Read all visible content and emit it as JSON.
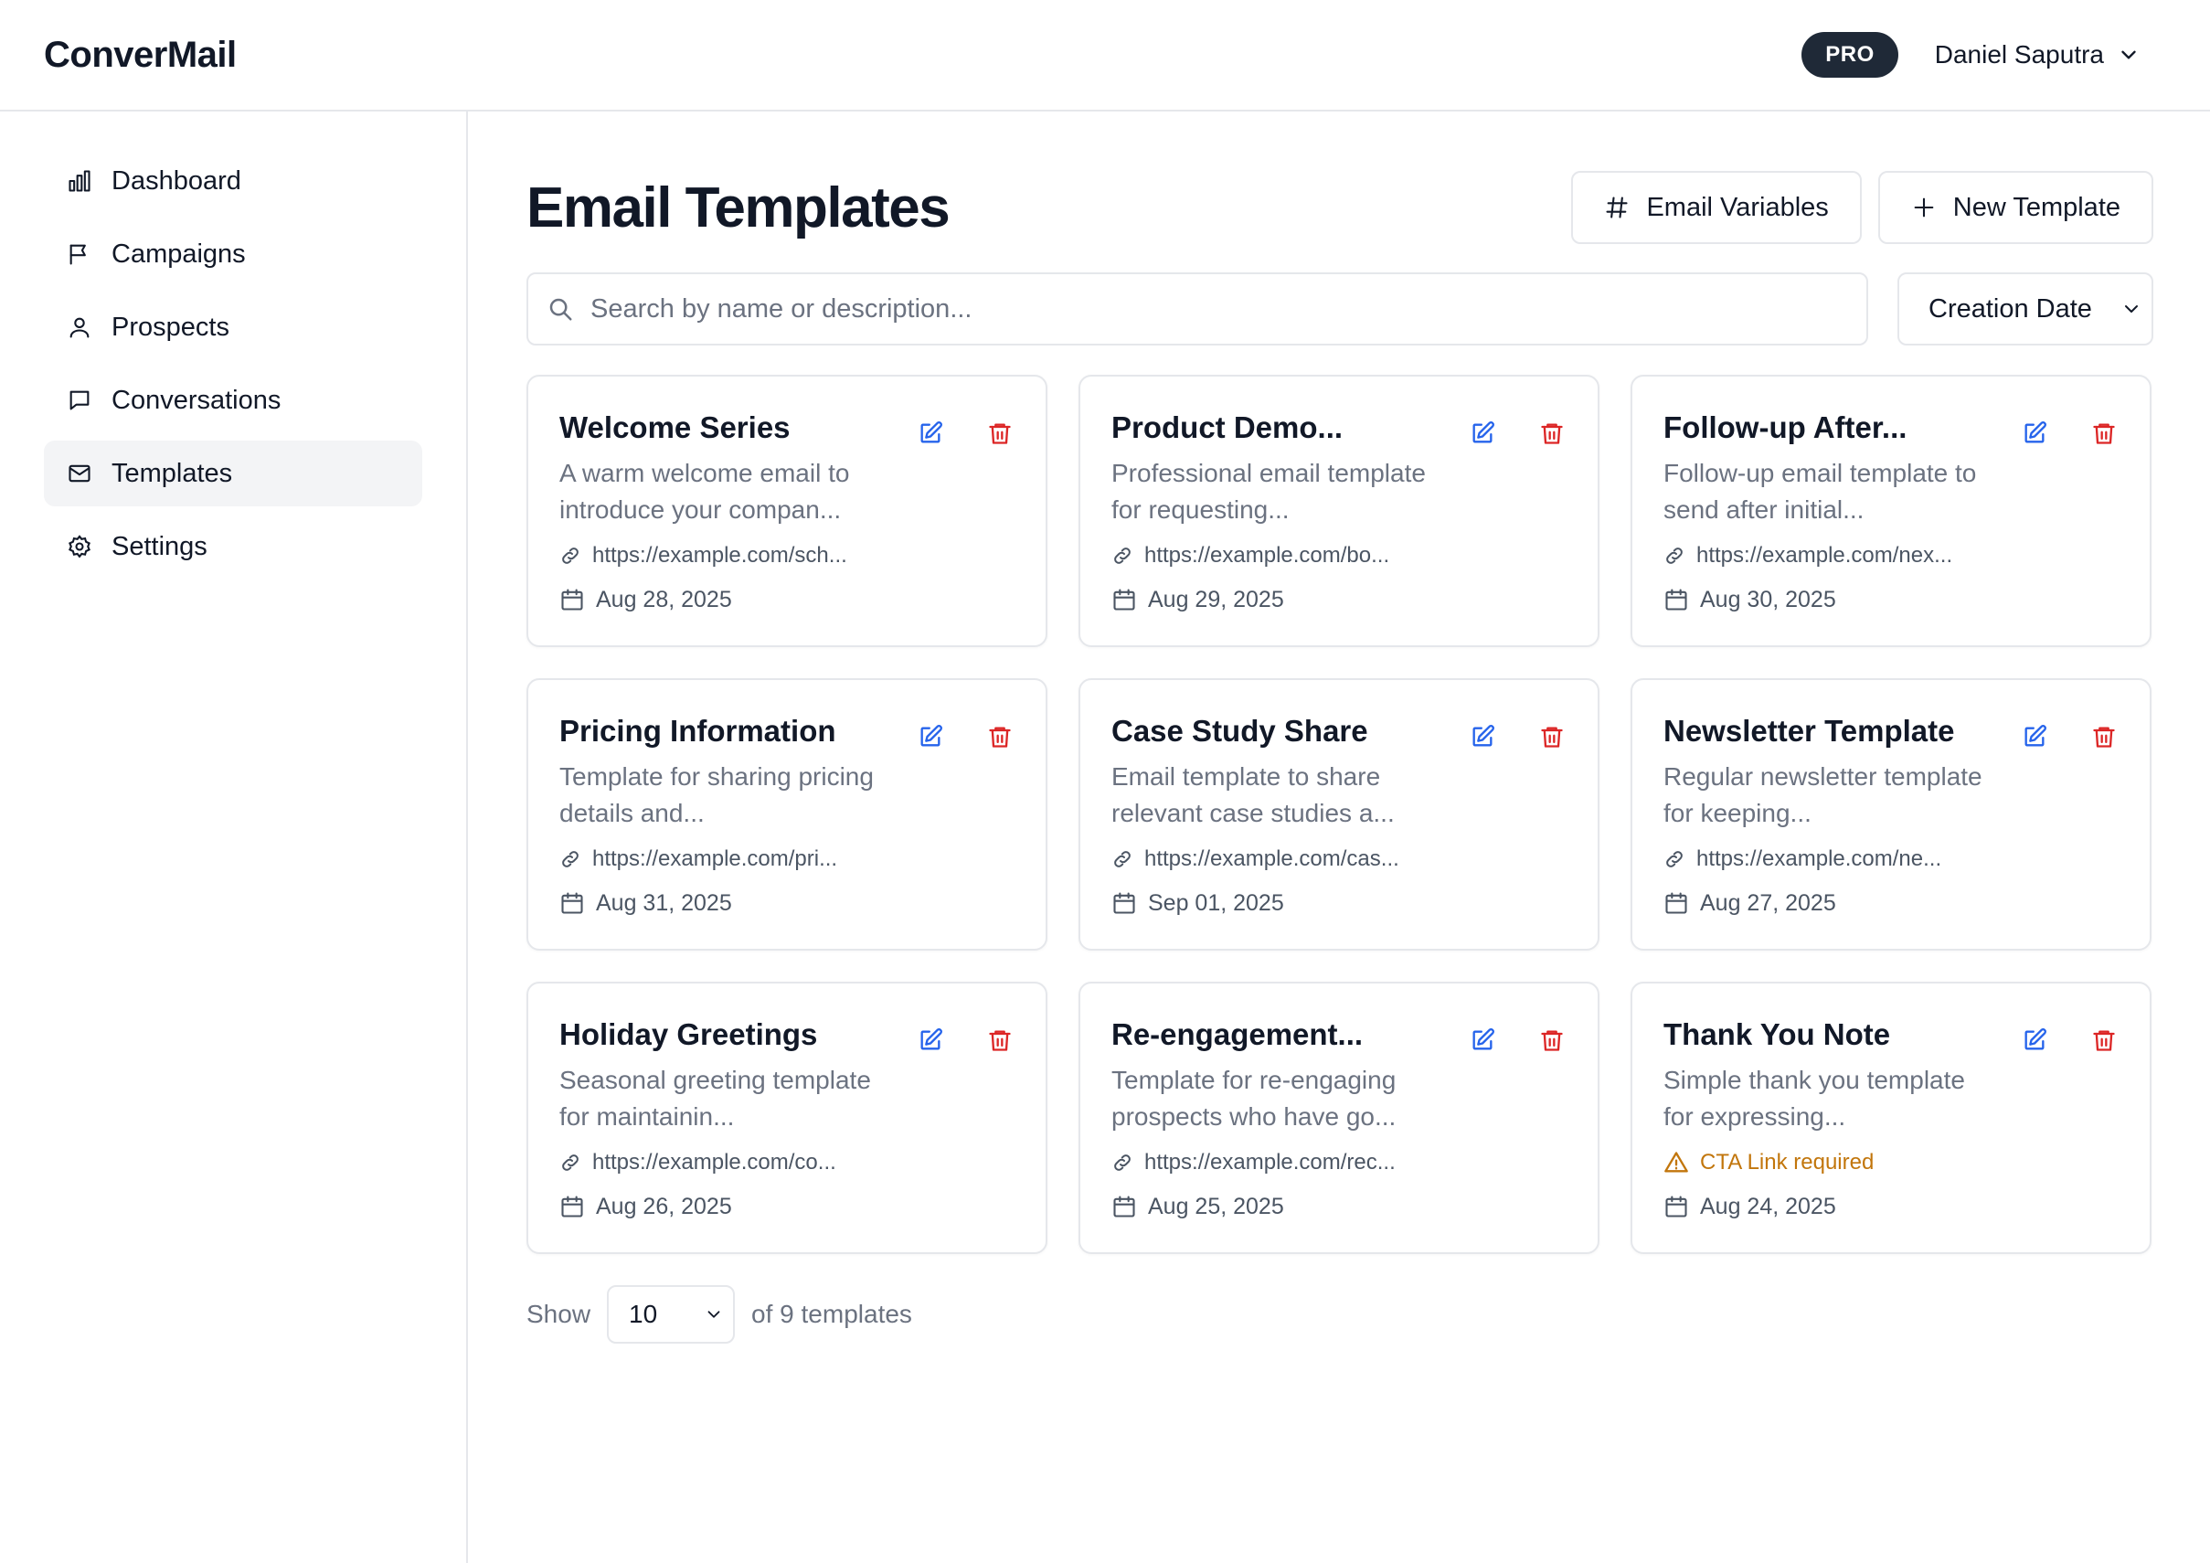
{
  "app": {
    "name": "ConverMail"
  },
  "header": {
    "badge": "PRO",
    "user_name": "Daniel Saputra"
  },
  "sidebar": {
    "items": [
      {
        "label": "Dashboard",
        "icon": "chart-bar-icon",
        "active": false
      },
      {
        "label": "Campaigns",
        "icon": "flag-icon",
        "active": false
      },
      {
        "label": "Prospects",
        "icon": "user-icon",
        "active": false
      },
      {
        "label": "Conversations",
        "icon": "chat-bubble-icon",
        "active": false
      },
      {
        "label": "Templates",
        "icon": "mail-icon",
        "active": true
      },
      {
        "label": "Settings",
        "icon": "gear-icon",
        "active": false
      }
    ]
  },
  "page": {
    "title": "Email Templates",
    "actions": {
      "variables_label": "Email Variables",
      "new_label": "New Template"
    }
  },
  "search": {
    "placeholder": "Search by name or description...",
    "value": ""
  },
  "sort": {
    "selected": "Creation Date"
  },
  "templates": [
    {
      "title": "Welcome Series",
      "desc": "A warm welcome email to introduce your compan...",
      "link": "https://example.com/sch...",
      "date": "Aug 28, 2025"
    },
    {
      "title": "Product Demo...",
      "desc": "Professional email template for requesting...",
      "link": "https://example.com/bo...",
      "date": "Aug 29, 2025"
    },
    {
      "title": "Follow-up After...",
      "desc": "Follow-up email template to send after initial...",
      "link": "https://example.com/nex...",
      "date": "Aug 30, 2025"
    },
    {
      "title": "Pricing Information",
      "desc": "Template for sharing pricing details and...",
      "link": "https://example.com/pri...",
      "date": "Aug 31, 2025"
    },
    {
      "title": "Case Study Share",
      "desc": "Email template to share relevant case studies a...",
      "link": "https://example.com/cas...",
      "date": "Sep 01, 2025"
    },
    {
      "title": "Newsletter Template",
      "desc": "Regular newsletter template for keeping...",
      "link": "https://example.com/ne...",
      "date": "Aug 27, 2025"
    },
    {
      "title": "Holiday Greetings",
      "desc": "Seasonal greeting template for maintainin...",
      "link": "https://example.com/co...",
      "date": "Aug 26, 2025"
    },
    {
      "title": "Re-engagement...",
      "desc": "Template for re-engaging prospects who have go...",
      "link": "https://example.com/rec...",
      "date": "Aug 25, 2025"
    },
    {
      "title": "Thank You Note",
      "desc": "Simple thank you template for expressing...",
      "link": "CTA Link required",
      "link_warning": true,
      "date": "Aug 24, 2025"
    }
  ],
  "pagination": {
    "show_label": "Show",
    "page_size": "10",
    "summary": "of 9 templates"
  },
  "colors": {
    "edit": "#2563eb",
    "delete": "#dc2626",
    "warning": "#c2760c",
    "badge_bg": "#1f2937"
  }
}
